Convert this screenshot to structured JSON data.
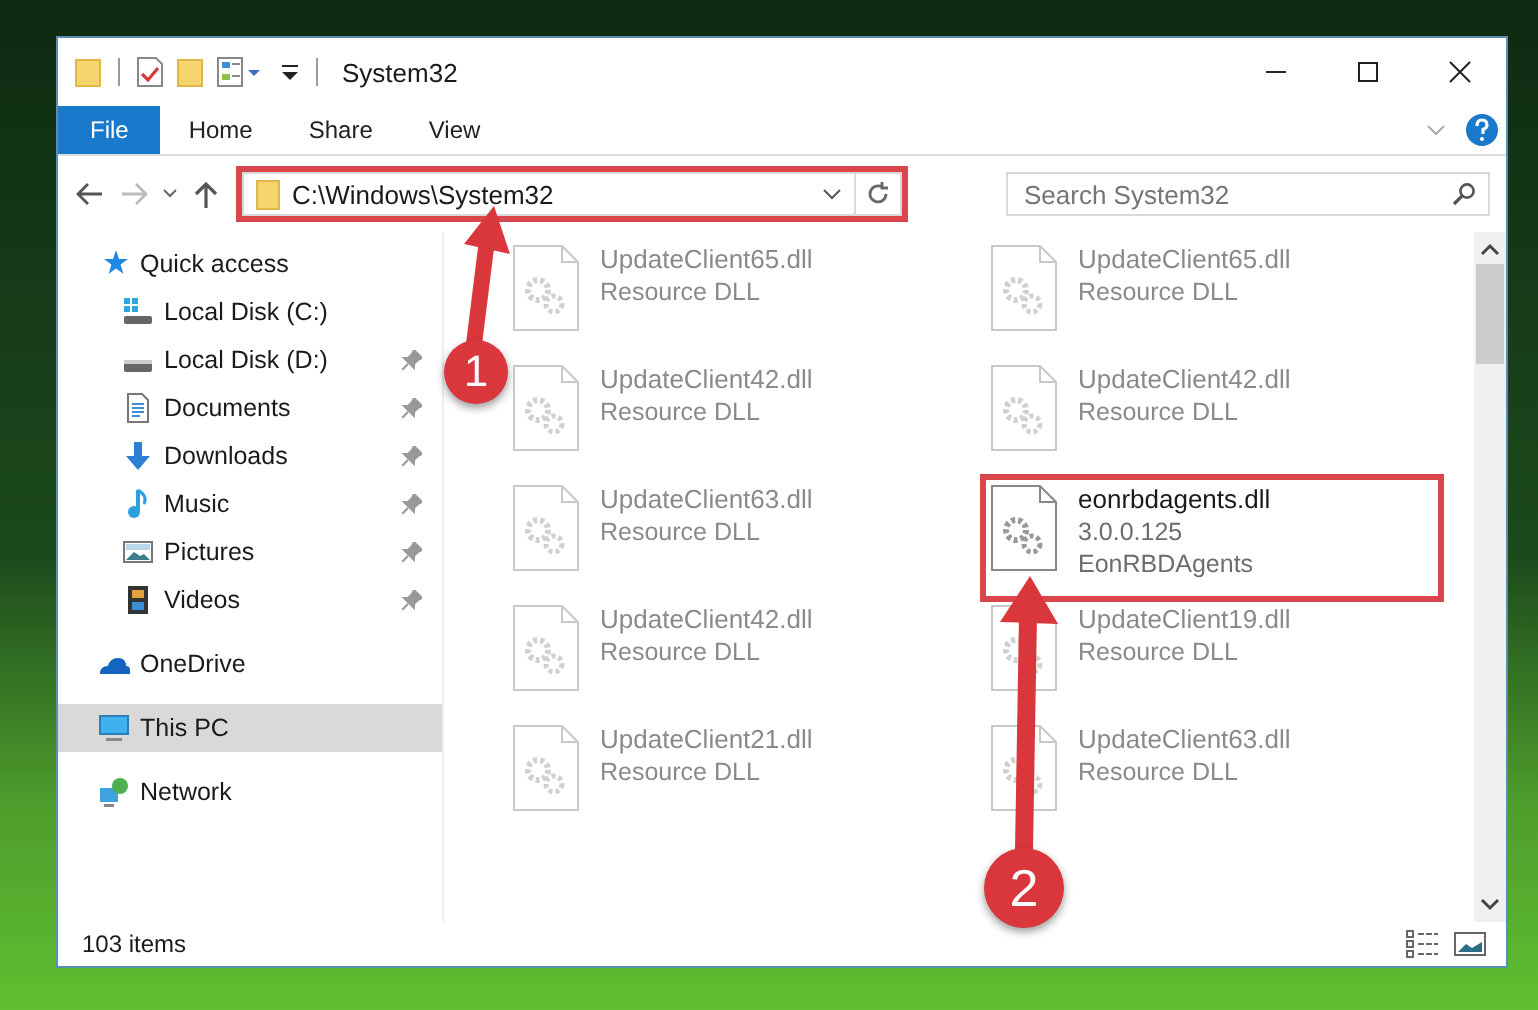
{
  "window": {
    "title": "System32"
  },
  "ribbon": {
    "tabs": [
      {
        "label": "File",
        "selected": true
      },
      {
        "label": "Home",
        "selected": false
      },
      {
        "label": "Share",
        "selected": false
      },
      {
        "label": "View",
        "selected": false
      }
    ]
  },
  "address_bar": {
    "path": "C:\\Windows\\System32",
    "highlighted": true
  },
  "search": {
    "placeholder": "Search System32"
  },
  "nav": [
    {
      "label": "Quick access",
      "kind": "star",
      "selected": false,
      "children": [
        {
          "label": "Local Disk (C:)",
          "kind": "winDrive",
          "pinned": false,
          "selected": false
        },
        {
          "label": "Local Disk (D:)",
          "kind": "drive",
          "pinned": true,
          "selected": false
        },
        {
          "label": "Documents",
          "kind": "documents",
          "pinned": true,
          "selected": false
        },
        {
          "label": "Downloads",
          "kind": "downloads",
          "pinned": true,
          "selected": false
        },
        {
          "label": "Music",
          "kind": "music",
          "pinned": true,
          "selected": false
        },
        {
          "label": "Pictures",
          "kind": "pictures",
          "pinned": true,
          "selected": false
        },
        {
          "label": "Videos",
          "kind": "videos",
          "pinned": true,
          "selected": false
        }
      ]
    },
    {
      "label": "OneDrive",
      "kind": "cloud",
      "selected": false
    },
    {
      "label": "This PC",
      "kind": "pc",
      "selected": true
    },
    {
      "label": "Network",
      "kind": "network",
      "selected": false
    }
  ],
  "files": [
    {
      "name": "UpdateClient65.dll",
      "details": [
        "Resource DLL"
      ],
      "dimmed": true,
      "highlighted": false
    },
    {
      "name": "UpdateClient65.dll",
      "details": [
        "Resource DLL"
      ],
      "dimmed": true,
      "highlighted": false
    },
    {
      "name": "UpdateClient42.dll",
      "details": [
        "Resource DLL"
      ],
      "dimmed": true,
      "highlighted": false
    },
    {
      "name": "UpdateClient42.dll",
      "details": [
        "Resource DLL"
      ],
      "dimmed": true,
      "highlighted": false
    },
    {
      "name": "UpdateClient63.dll",
      "details": [
        "Resource DLL"
      ],
      "dimmed": true,
      "highlighted": false
    },
    {
      "name": "eonrbdagents.dll",
      "details": [
        "3.0.0.125",
        "EonRBDAgents"
      ],
      "dimmed": false,
      "highlighted": true
    },
    {
      "name": "UpdateClient42.dll",
      "details": [
        "Resource DLL"
      ],
      "dimmed": true,
      "highlighted": false
    },
    {
      "name": "UpdateClient19.dll",
      "details": [
        "Resource DLL"
      ],
      "dimmed": true,
      "highlighted": false
    },
    {
      "name": "UpdateClient21.dll",
      "details": [
        "Resource DLL"
      ],
      "dimmed": true,
      "highlighted": false
    },
    {
      "name": "UpdateClient63.dll",
      "details": [
        "Resource DLL"
      ],
      "dimmed": true,
      "highlighted": false
    }
  ],
  "status_bar": {
    "item_count": "103 items"
  },
  "callouts": [
    {
      "label": "1"
    },
    {
      "label": "2"
    }
  ]
}
